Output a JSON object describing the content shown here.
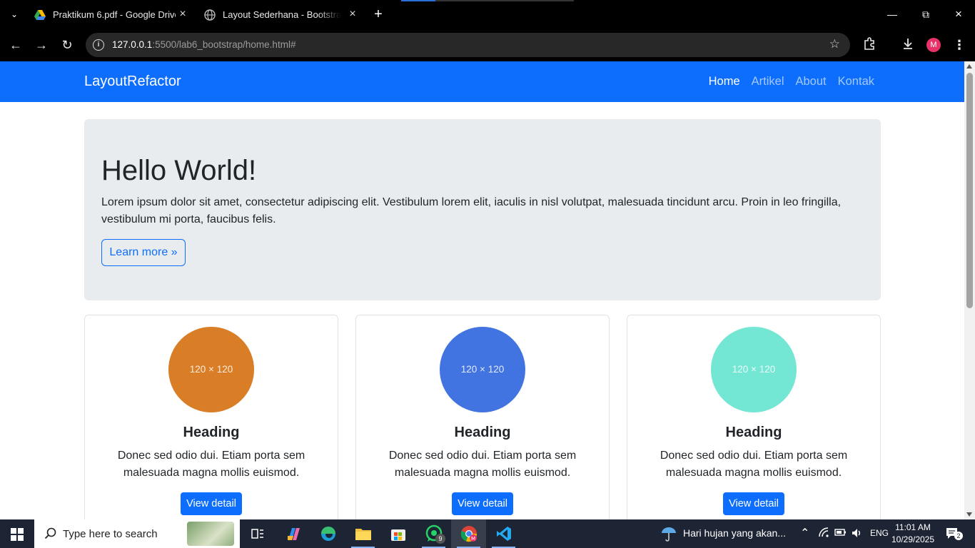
{
  "browser": {
    "tabs": [
      {
        "title": "Praktikum 6.pdf - Google Drive",
        "favicon": "google-drive-icon"
      },
      {
        "title": "Layout Sederhana - Bootstrap R",
        "favicon": "globe-icon"
      }
    ],
    "url_host": "127.0.0.1",
    "url_path": ":5500/lab6_bootstrap/home.html#",
    "avatar_letter": "M"
  },
  "page": {
    "brand": "LayoutRefactor",
    "nav": [
      "Home",
      "Artikel",
      "About",
      "Kontak"
    ],
    "hero": {
      "title": "Hello World!",
      "text": "Lorem ipsum dolor sit amet, consectetur adipiscing elit. Vestibulum lorem elit, iaculis in nisl volutpat, malesuada tincidunt arcu. Proin in leo fringilla, vestibulum mi porta, faucibus felis.",
      "button": "Learn more »"
    },
    "cards": [
      {
        "image_label": "120 × 120",
        "color": "#d97e26",
        "heading": "Heading",
        "text": "Donec sed odio dui. Etiam porta sem malesuada magna mollis euismod.",
        "button": "View detail"
      },
      {
        "image_label": "120 × 120",
        "color": "#4174e0",
        "heading": "Heading",
        "text": "Donec sed odio dui. Etiam porta sem malesuada magna mollis euismod.",
        "button": "View detail"
      },
      {
        "image_label": "120 × 120",
        "color": "#74e6d4",
        "heading": "Heading",
        "text": "Donec sed odio dui. Etiam porta sem malesuada magna mollis euismod.",
        "button": "View detail"
      }
    ]
  },
  "taskbar": {
    "search_placeholder": "Type here to search",
    "weather": "Hari hujan yang akan...",
    "language": "ENG",
    "time": "11:01 AM",
    "date": "10/29/2025",
    "whatsapp_badge": "9",
    "notification_count": "2"
  },
  "colors": {
    "primary": "#0d6efd",
    "jumbotron": "#e9ecef"
  }
}
